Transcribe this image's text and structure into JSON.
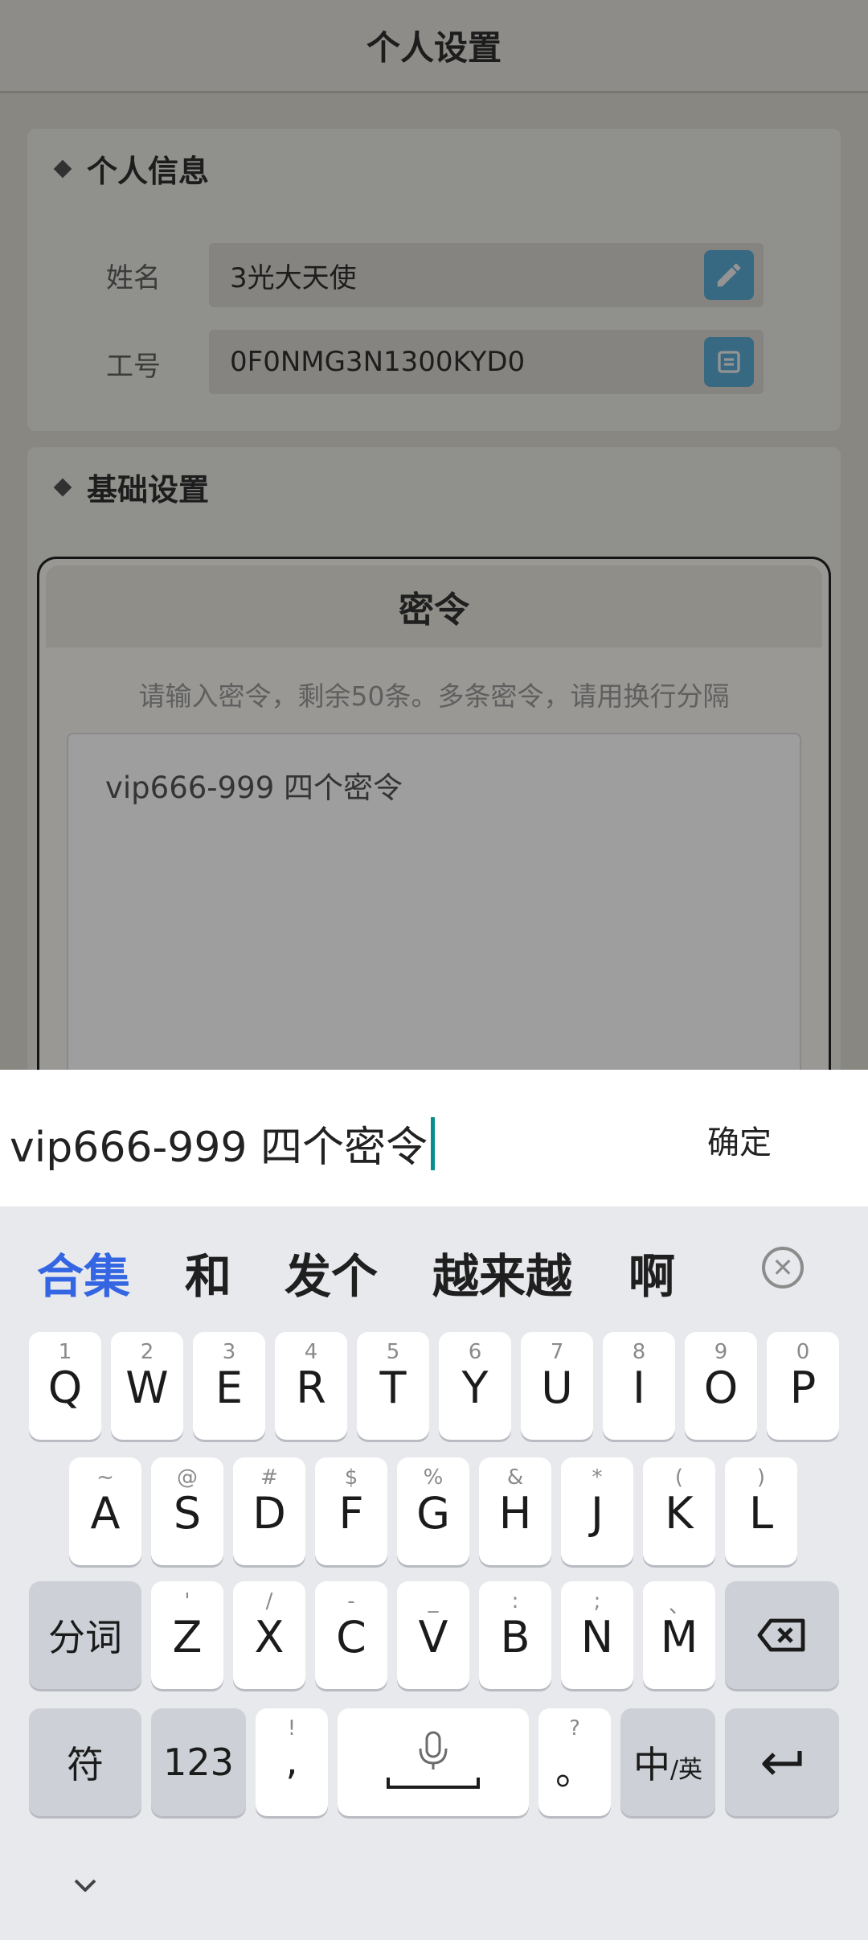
{
  "header": {
    "title": "个人设置"
  },
  "personal_info": {
    "title": "个人信息",
    "name_label": "姓名",
    "name_value": "3光大天使",
    "id_label": "工号",
    "id_value": "0F0NMG3N1300KYD0"
  },
  "basic_settings": {
    "title": "基础设置"
  },
  "dialog": {
    "title": "密令",
    "hint": "请输入密令，剩余50条。多条密令，请用换行分隔",
    "textarea_value": "vip666-999 四个密令"
  },
  "input_bar": {
    "text": "vip666-999 四个密令",
    "confirm_label": "确定"
  },
  "keyboard": {
    "candidates": [
      "合集",
      "和",
      "发个",
      "越来越",
      "啊"
    ],
    "row1": [
      {
        "hint": "1",
        "key": "Q"
      },
      {
        "hint": "2",
        "key": "W"
      },
      {
        "hint": "3",
        "key": "E"
      },
      {
        "hint": "4",
        "key": "R"
      },
      {
        "hint": "5",
        "key": "T"
      },
      {
        "hint": "6",
        "key": "Y"
      },
      {
        "hint": "7",
        "key": "U"
      },
      {
        "hint": "8",
        "key": "I"
      },
      {
        "hint": "9",
        "key": "O"
      },
      {
        "hint": "0",
        "key": "P"
      }
    ],
    "row2": [
      {
        "hint": "~",
        "key": "A"
      },
      {
        "hint": "@",
        "key": "S"
      },
      {
        "hint": "#",
        "key": "D"
      },
      {
        "hint": "$",
        "key": "F"
      },
      {
        "hint": "%",
        "key": "G"
      },
      {
        "hint": "&",
        "key": "H"
      },
      {
        "hint": "*",
        "key": "J"
      },
      {
        "hint": "(",
        "key": "K"
      },
      {
        "hint": ")",
        "key": "L"
      }
    ],
    "row3": [
      {
        "hint": "'",
        "key": "Z"
      },
      {
        "hint": "/",
        "key": "X"
      },
      {
        "hint": "-",
        "key": "C"
      },
      {
        "hint": "_",
        "key": "V"
      },
      {
        "hint": ":",
        "key": "B"
      },
      {
        "hint": ";",
        "key": "N"
      },
      {
        "hint": "、",
        "key": "M"
      }
    ],
    "segment_label": "分词",
    "symbol_label": "符",
    "number_label": "123",
    "comma": {
      "hint": "!",
      "key": ","
    },
    "period": {
      "hint": "?",
      "key": "。"
    },
    "lang_main": "中",
    "lang_sub": "/英"
  },
  "icons": {
    "edit": "pencil-icon",
    "copy": "copy-icon",
    "close": "close-circle-icon",
    "backspace": "backspace-icon",
    "mic": "microphone-icon",
    "enter": "enter-icon",
    "hide": "chevron-down-icon"
  },
  "colors": {
    "accent_candidate": "#3466e3",
    "caret": "#0a8d8d",
    "action_button": "#5fb5e0"
  }
}
